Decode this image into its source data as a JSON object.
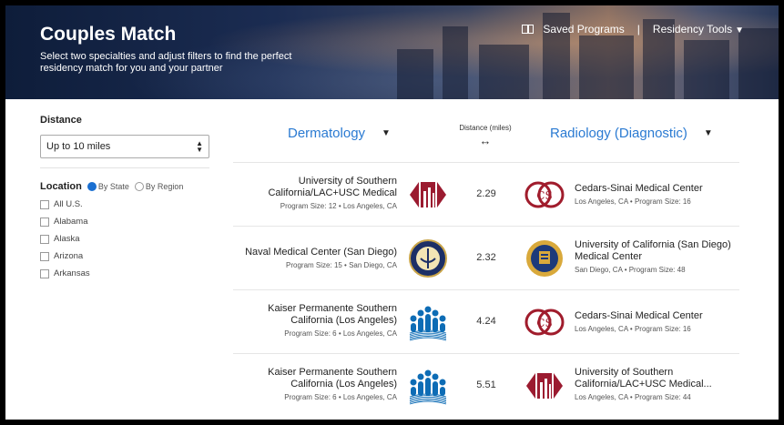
{
  "header": {
    "title": "Couples Match",
    "subtitle": "Select two specialties and adjust filters to find the perfect residency match for you and your partner",
    "saved_programs": "Saved Programs",
    "separator": "|",
    "residency_tools": "Residency Tools"
  },
  "filters": {
    "distance_label": "Distance",
    "distance_value": "Up to 10 miles",
    "location_label": "Location",
    "by_state": "By State",
    "by_region": "By Region",
    "selected_mode": "By State",
    "states": [
      "All U.S.",
      "Alabama",
      "Alaska",
      "Arizona",
      "Arkansas"
    ]
  },
  "columns": {
    "left_specialty": "Dermatology",
    "right_specialty": "Radiology (Diagnostic)",
    "distance_label": "Distance (miles)",
    "distance_icon": "↔"
  },
  "matches": [
    {
      "left": {
        "name": "University of Southern California/LAC+USC Medical",
        "meta": "Program Size: 12 • Los Angeles, CA",
        "logo": "usc-logo"
      },
      "distance": "2.29",
      "right": {
        "name": "Cedars-Sinai Medical Center",
        "meta": "Los Angeles, CA • Program Size: 16",
        "logo": "cedars-logo"
      }
    },
    {
      "left": {
        "name": "Naval Medical Center (San Diego)",
        "meta": "Program Size: 15 • San Diego, CA",
        "logo": "navy-seal-logo"
      },
      "distance": "2.32",
      "right": {
        "name": "University of California (San Diego) Medical Center",
        "meta": "San Diego, CA • Program Size: 48",
        "logo": "uc-seal-logo"
      }
    },
    {
      "left": {
        "name": "Kaiser Permanente Southern California (Los Angeles)",
        "meta": "Program Size: 6 • Los Angeles, CA",
        "logo": "kaiser-logo"
      },
      "distance": "4.24",
      "right": {
        "name": "Cedars-Sinai Medical Center",
        "meta": "Los Angeles, CA • Program Size: 16",
        "logo": "cedars-logo"
      }
    },
    {
      "left": {
        "name": "Kaiser Permanente Southern California (Los Angeles)",
        "meta": "Program Size: 6 • Los Angeles, CA",
        "logo": "kaiser-logo"
      },
      "distance": "5.51",
      "right": {
        "name": "University of Southern California/LAC+USC Medical...",
        "meta": "Los Angeles, CA • Program Size: 44",
        "logo": "usc-logo"
      }
    }
  ],
  "colors": {
    "accent": "#2a7ad2",
    "radio_on": "#1a6fd1",
    "usc": "#9b1b30",
    "kaiser": "#0d6cb5",
    "cedars": "#a01c2c"
  }
}
